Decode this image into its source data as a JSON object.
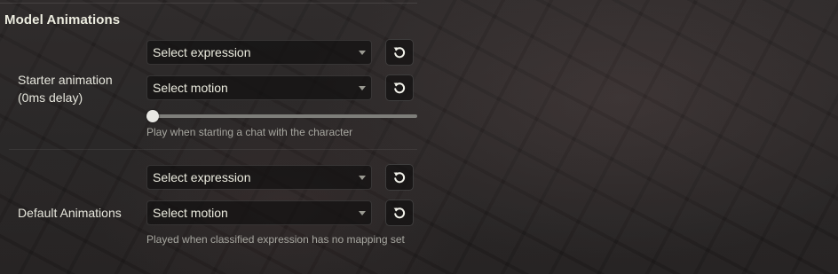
{
  "section": {
    "title": "Model Animations"
  },
  "starter": {
    "label_line1": "Starter animation",
    "label_line2": "(0ms delay)",
    "expression_select": "Select expression",
    "motion_select": "Select motion",
    "delay_slider_value": 0,
    "hint": "Play when starting a chat with the character"
  },
  "default": {
    "label": "Default Animations",
    "expression_select": "Select expression",
    "motion_select": "Select motion",
    "hint": "Played when classified expression has no mapping set"
  },
  "icons": {
    "reset": "rotate-ccw-icon",
    "dropdown": "caret-down-icon"
  }
}
